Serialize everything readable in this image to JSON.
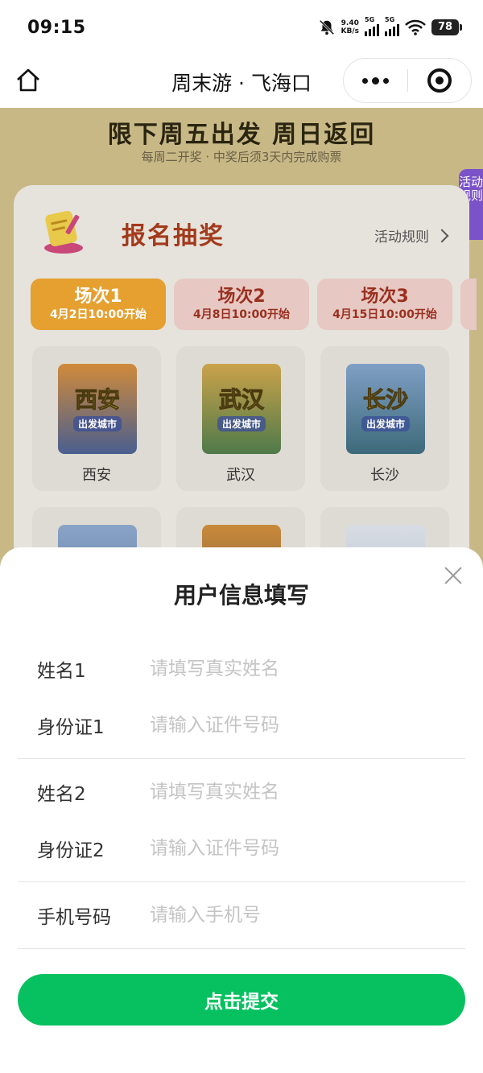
{
  "status_bar": {
    "time": "09:15",
    "net_speed_value": "9.40",
    "net_speed_unit": "KB/s",
    "sim1": "5G",
    "sim2": "5G",
    "battery": "78"
  },
  "nav": {
    "title": "周末游 · 飞海口",
    "icons": [
      "home-icon",
      "more-icon",
      "target-icon"
    ]
  },
  "banner": {
    "title": "限下周五出发 周日返回",
    "subtitle": "每周二开奖 · 中奖后须3天内完成购票",
    "rules_tab": "活动规则"
  },
  "card": {
    "title": "报名抽奖",
    "rules_link": "活动规则",
    "sessions": [
      {
        "name": "场次1",
        "time": "4月2日10:00开始",
        "active": true
      },
      {
        "name": "场次2",
        "time": "4月8日10:00开始",
        "active": false
      },
      {
        "name": "场次3",
        "time": "4月15日10:00开始",
        "active": false
      }
    ],
    "cities": [
      {
        "name": "西安",
        "image_title": "西安",
        "image_sub": "出发城市",
        "colors": [
          "#d08a3a",
          "#4a5f8f"
        ]
      },
      {
        "name": "武汉",
        "image_title": "武汉",
        "image_sub": "出发城市",
        "colors": [
          "#caa24a",
          "#4f7a4a"
        ]
      },
      {
        "name": "长沙",
        "image_title": "长沙",
        "image_sub": "出发城市",
        "colors": [
          "#7f9fc4",
          "#3d6a7a"
        ]
      }
    ]
  },
  "sheet": {
    "title": "用户信息填写",
    "fields": {
      "name1_label": "姓名1",
      "name1_placeholder": "请填写真实姓名",
      "id1_label": "身份证1",
      "id1_placeholder": "请输入证件号码",
      "name2_label": "姓名2",
      "name2_placeholder": "请填写真实姓名",
      "id2_label": "身份证2",
      "id2_placeholder": "请输入证件号码",
      "phone_label": "手机号码",
      "phone_placeholder": "请输入手机号"
    },
    "submit_label": "点击提交"
  },
  "colors": {
    "primary_green": "#07c160",
    "session_active": "#e5a030",
    "session_inactive": "#e7c8c3",
    "rules_tab": "#7b52c8"
  }
}
